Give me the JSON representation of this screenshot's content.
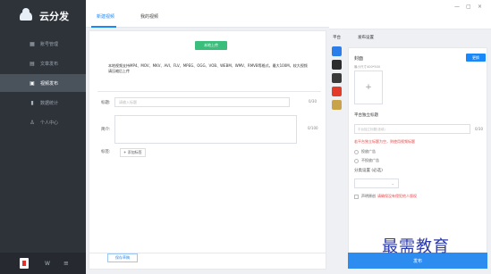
{
  "app": {
    "name": "云分发"
  },
  "sidebar": {
    "items": [
      {
        "label": "账号管理",
        "icon": "grid-icon"
      },
      {
        "label": "文章发布",
        "icon": "article-icon"
      },
      {
        "label": "视频发布",
        "icon": "video-icon"
      },
      {
        "label": "数据统计",
        "icon": "chart-icon"
      },
      {
        "label": "个人中心",
        "icon": "user-icon"
      }
    ],
    "active_index": 2,
    "bottom": {
      "w_label": "W",
      "menu_icon": "≡"
    }
  },
  "tabs": [
    {
      "label": "新建视频"
    },
    {
      "label": "我的视频"
    }
  ],
  "upload": {
    "button_label": "本地上传",
    "support_text": "本地视频支持MP4、MOV、MKV、AVI、FLV、MPEG、OGG、VOB、WEBM、WMV、RMVB等格式，最大100M，较大视频请压缩后上传"
  },
  "form": {
    "title_label": "标题:",
    "title_placeholder": "请输入标题",
    "title_count": "0/30",
    "intro_label": "简介:",
    "intro_count": "0/100",
    "tag_label": "标签:",
    "tag_add": "+ 添加标签"
  },
  "footer": {
    "draft_button": "保存草稿"
  },
  "right_panel": {
    "tab_platform": "平台",
    "tab_settings": "发布设置",
    "cover_label": "封面",
    "cover_button": "更换",
    "cover_hint": "最小尺寸400*500",
    "cover_plus": "+",
    "platform_title_label": "平台独立标题",
    "platform_title_placeholder": "平台独立标题(选填)",
    "platform_title_count": "0/30",
    "warning": "若平台独立标题为空，则使用视频标题",
    "ad_option_1": "投放广告",
    "ad_option_2": "不投放广告",
    "category_label": "分类设置 (必选)",
    "category_placeholder": "",
    "statement_label": "声明原创",
    "statement_warning": "请确保没有侵犯他人版权"
  },
  "publish_button": "发布",
  "window_controls": {
    "minimize": "—",
    "maximize": "▢",
    "close": "×"
  },
  "watermark": "最需教育"
}
